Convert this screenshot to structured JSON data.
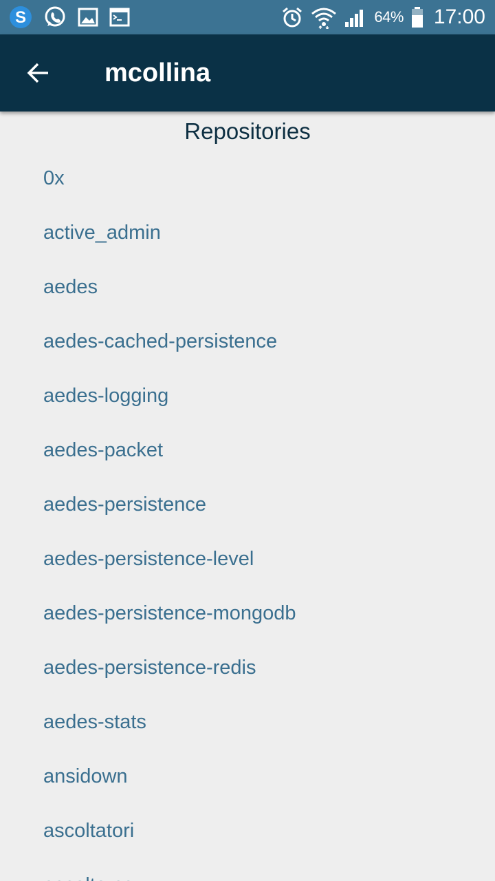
{
  "status_bar": {
    "icons_left": [
      "skype-icon",
      "whatsapp-icon",
      "gallery-icon",
      "terminal-icon"
    ],
    "icons_right": [
      "alarm-icon",
      "wifi-icon",
      "cell-signal-icon",
      "battery-icon"
    ],
    "battery_percent": "64%",
    "time": "17:00",
    "background_color": "#3c7393"
  },
  "app_bar": {
    "back_icon": "arrow-back-icon",
    "title": "mcollina",
    "background_color": "#0a3146"
  },
  "content": {
    "heading": "Repositories",
    "repositories": [
      "0x",
      "active_admin",
      "aedes",
      "aedes-cached-persistence",
      "aedes-logging",
      "aedes-packet",
      "aedes-persistence",
      "aedes-persistence-level",
      "aedes-persistence-mongodb",
      "aedes-persistence-redis",
      "aedes-stats",
      "ansidown",
      "ascoltatori",
      "ascolto-cc"
    ],
    "link_color": "#3a6f8f",
    "background_color": "#eeeeee"
  }
}
